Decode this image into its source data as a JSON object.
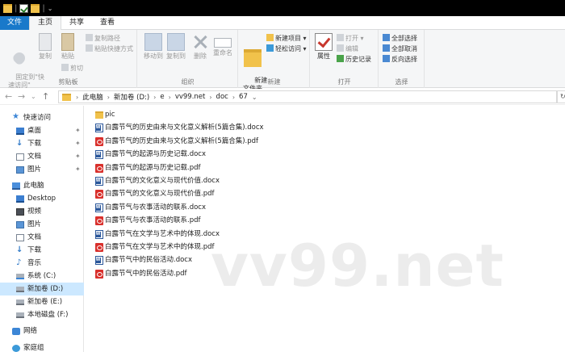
{
  "titlebar": {
    "icons": [
      "folder-icon",
      "properties-check-icon",
      "folder-icon"
    ],
    "separator": "|",
    "dropdown_glyph": "⌄"
  },
  "tabs": [
    {
      "label": "文件",
      "kind": "file"
    },
    {
      "label": "主页",
      "kind": "active"
    },
    {
      "label": "共享",
      "kind": "normal"
    },
    {
      "label": "查看",
      "kind": "normal"
    }
  ],
  "ribbon": {
    "clipboard": {
      "pin_label": "固定到\"快\n速访问\"",
      "copy_label": "复制",
      "paste_label": "粘贴",
      "copy_path": "复制路径",
      "paste_shortcut": "粘贴快捷方式",
      "cut": "剪切",
      "group": "剪贴板"
    },
    "organize": {
      "move_to": "移动到",
      "copy_to": "复制到",
      "delete": "删除",
      "rename": "重命名",
      "group": "组织"
    },
    "new": {
      "new_folder": "新建\n文件夹",
      "new_item": "新建项目 ▾",
      "easy_access": "轻松访问 ▾",
      "group": "新建"
    },
    "open": {
      "properties": "属性",
      "open": "打开 ▾",
      "edit": "编辑",
      "history": "历史记录",
      "group": "打开"
    },
    "select": {
      "select_all": "全部选择",
      "select_none": "全部取消",
      "invert": "反向选择",
      "group": "选择"
    }
  },
  "address": {
    "back": "←",
    "forward": "→",
    "recent": "⌄",
    "up": "↑",
    "path": [
      "此电脑",
      "新加卷 (D:)",
      "e",
      "vv99.net",
      "doc",
      "67"
    ],
    "path_sep": "›",
    "lead_sep": "›",
    "trailing": "⌄"
  },
  "search_edge": "↻",
  "nav": {
    "items": [
      {
        "label": "快速访问",
        "icon": "star-icon",
        "indent": 0,
        "pinned": false,
        "selected": false
      },
      {
        "label": "桌面",
        "icon": "desktop-icon",
        "indent": 1,
        "pinned": true,
        "selected": false
      },
      {
        "label": "下载",
        "icon": "download-icon",
        "indent": 1,
        "pinned": true,
        "selected": false
      },
      {
        "label": "文档",
        "icon": "documents-icon",
        "indent": 1,
        "pinned": true,
        "selected": false
      },
      {
        "label": "图片",
        "icon": "pictures-icon",
        "indent": 1,
        "pinned": true,
        "selected": false
      },
      {
        "label": "此电脑",
        "icon": "this-pc-icon",
        "indent": 0,
        "pinned": false,
        "selected": false
      },
      {
        "label": "Desktop",
        "icon": "desktop-icon",
        "indent": 1,
        "pinned": false,
        "selected": false
      },
      {
        "label": "视频",
        "icon": "videos-icon",
        "indent": 1,
        "pinned": false,
        "selected": false
      },
      {
        "label": "图片",
        "icon": "pictures-icon",
        "indent": 1,
        "pinned": false,
        "selected": false
      },
      {
        "label": "文档",
        "icon": "documents-icon",
        "indent": 1,
        "pinned": false,
        "selected": false
      },
      {
        "label": "下载",
        "icon": "download-icon",
        "indent": 1,
        "pinned": false,
        "selected": false
      },
      {
        "label": "音乐",
        "icon": "music-icon",
        "indent": 1,
        "pinned": false,
        "selected": false
      },
      {
        "label": "系统 (C:)",
        "icon": "system-drive-icon",
        "indent": 1,
        "pinned": false,
        "selected": false
      },
      {
        "label": "新加卷 (D:)",
        "icon": "drive-icon",
        "indent": 1,
        "pinned": false,
        "selected": true
      },
      {
        "label": "新加卷 (E:)",
        "icon": "drive-icon",
        "indent": 1,
        "pinned": false,
        "selected": false
      },
      {
        "label": "本地磁盘 (F:)",
        "icon": "drive-icon",
        "indent": 1,
        "pinned": false,
        "selected": false
      },
      {
        "label": "网络",
        "icon": "network-icon",
        "indent": 0,
        "pinned": false,
        "selected": false
      },
      {
        "label": "家庭组",
        "icon": "homegroup-icon",
        "indent": 0,
        "pinned": false,
        "selected": false
      }
    ],
    "pin_glyph": "✦"
  },
  "files": [
    {
      "name": "pic",
      "type": "folder"
    },
    {
      "name": "白露节气的历史由来与文化意义解析(5篇合集).docx",
      "type": "docx"
    },
    {
      "name": "白露节气的历史由来与文化意义解析(5篇合集).pdf",
      "type": "pdf"
    },
    {
      "name": "白露节气的起源与历史记载.docx",
      "type": "docx"
    },
    {
      "name": "白露节气的起源与历史记载.pdf",
      "type": "pdf"
    },
    {
      "name": "白露节气的文化意义与现代价值.docx",
      "type": "docx"
    },
    {
      "name": "白露节气的文化意义与现代价值.pdf",
      "type": "pdf"
    },
    {
      "name": "白露节气与农事活动的联系.docx",
      "type": "docx"
    },
    {
      "name": "白露节气与农事活动的联系.pdf",
      "type": "pdf"
    },
    {
      "name": "白露节气在文学与艺术中的体现.docx",
      "type": "docx"
    },
    {
      "name": "白露节气在文学与艺术中的体现.pdf",
      "type": "pdf"
    },
    {
      "name": "白露节气中的民俗活动.docx",
      "type": "docx"
    },
    {
      "name": "白露节气中的民俗活动.pdf",
      "type": "pdf"
    }
  ],
  "watermark": "vv99.net",
  "colors": {
    "accent": "#1979ca",
    "selection": "#cce8ff",
    "folder": "#f1c24b",
    "pdf": "#d9302c",
    "word": "#2b579a"
  }
}
